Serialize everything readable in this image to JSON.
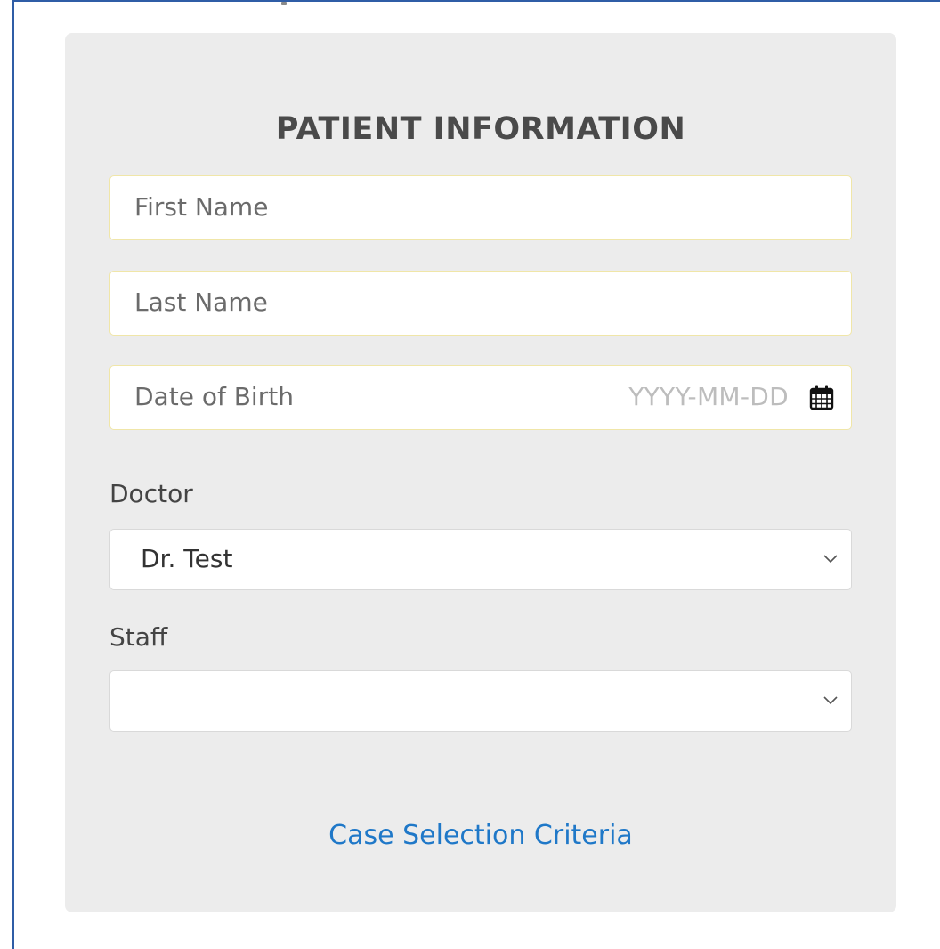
{
  "form": {
    "title": "PATIENT INFORMATION",
    "first_name": {
      "placeholder": "First Name",
      "value": ""
    },
    "last_name": {
      "placeholder": "Last Name",
      "value": ""
    },
    "date_of_birth": {
      "placeholder": "Date of Birth",
      "format_hint": "YYYY-MM-DD",
      "icon": "calendar-icon"
    },
    "doctor": {
      "label": "Doctor",
      "selected": "Dr. Test",
      "icon": "chevron-down-icon"
    },
    "staff": {
      "label": "Staff",
      "selected": "",
      "icon": "chevron-down-icon"
    },
    "link_text": "Case Selection Criteria"
  },
  "colors": {
    "card_background": "#ececec",
    "input_border": "#f0e6a8",
    "link": "#1f78c8",
    "title": "#4a4a4a",
    "frame": "#2f5da6"
  }
}
